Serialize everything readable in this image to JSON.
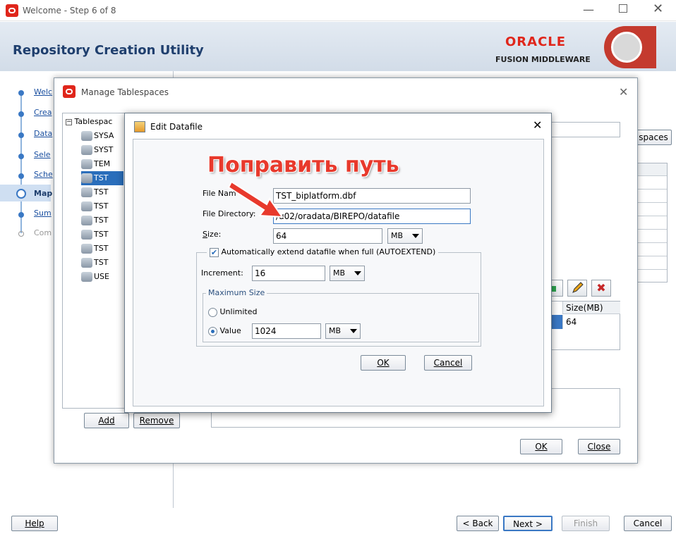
{
  "window": {
    "title": "Welcome - Step 6 of 8",
    "header": "Repository Creation Utility",
    "brand_top": "ORACLE",
    "brand_bottom": "FUSION MIDDLEWARE"
  },
  "steps": [
    {
      "label": "Welc"
    },
    {
      "label": "Crea"
    },
    {
      "label": "Data"
    },
    {
      "label": "Sele"
    },
    {
      "label": "Sche"
    },
    {
      "label": "Map"
    },
    {
      "label": "Sum"
    },
    {
      "label": "Com"
    }
  ],
  "bg_buttons": {
    "tablespaces": "spaces"
  },
  "nav": {
    "help": "Help",
    "back": "< Back",
    "next": "Next >",
    "finish": "Finish",
    "cancel": "Cancel"
  },
  "manage": {
    "title": "Manage Tablespaces",
    "tree_root": "Tablespac",
    "tree_items": [
      "SYSA",
      "SYST",
      "TEM",
      "TST",
      "TST",
      "TST",
      "TST",
      "TST",
      "TST",
      "TST",
      "USE"
    ],
    "add": "Add",
    "remove": "Remove",
    "ok": "OK",
    "close": "Close",
    "datafile_col": "Size(MB)",
    "datafile_val": "64"
  },
  "edit": {
    "title": "Edit Datafile",
    "file_name_label": "File Nam",
    "file_name": "TST_biplatform.dbf",
    "file_dir_label": "File Directory:",
    "file_dir": "/u02/oradata/BIREPO/datafile",
    "size_label": "Size:",
    "size": "64",
    "size_unit": "MB",
    "autoextend_label": "Automatically extend datafile when full (AUTOEXTEND)",
    "increment_label": "Increment:",
    "increment": "16",
    "increment_unit": "MB",
    "max_size_label": "Maximum Size",
    "unlimited_label": "Unlimited",
    "value_label": "Value",
    "value": "1024",
    "value_unit": "MB",
    "ok": "OK",
    "cancel": "Cancel"
  },
  "annotation": {
    "text": "Поправить путь",
    "color": "#e8392c"
  }
}
